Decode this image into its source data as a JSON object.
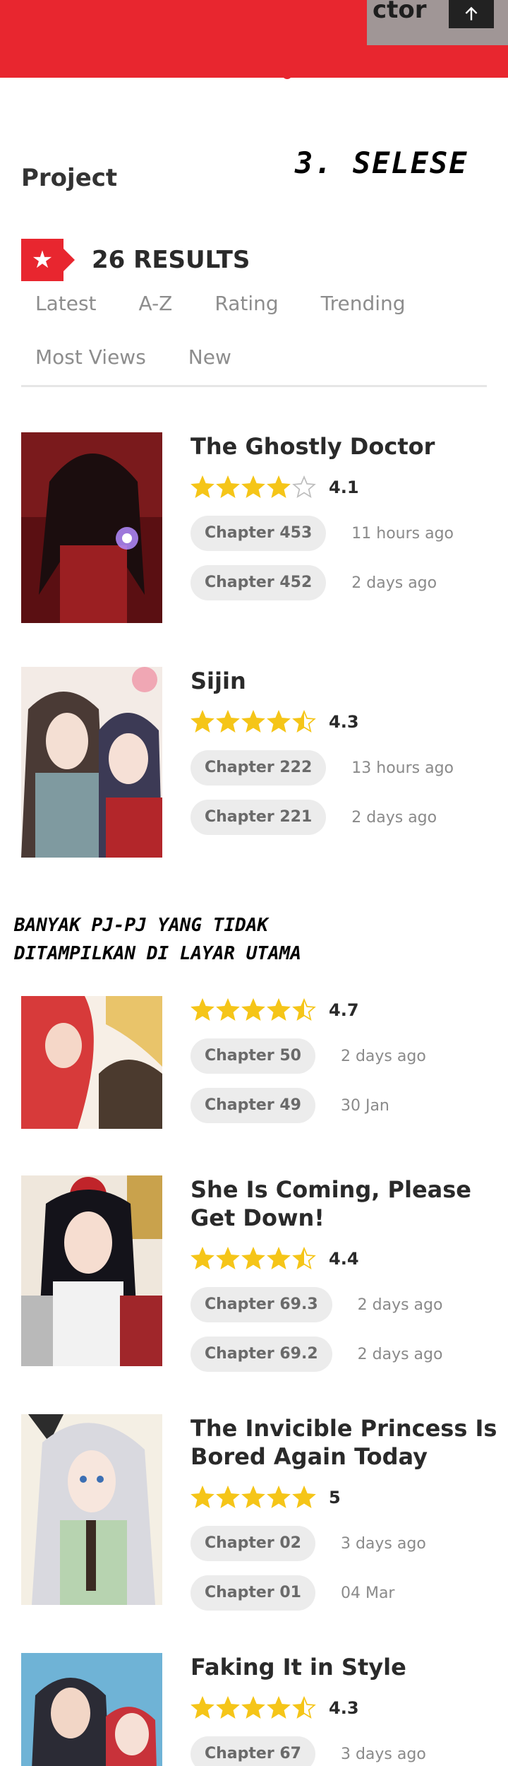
{
  "header": {
    "title_fragment": "ctor",
    "scroll_top_label": "back to top"
  },
  "annotations": {
    "top_note": "3. SELESE",
    "middle_note_line1": "BANYAK PJ-PJ YANG TIDAK",
    "middle_note_line2": "DITAMPILKAN DI LAYAR UTAMA"
  },
  "section": {
    "title": "Project",
    "results_count": "26 RESULTS",
    "sort_tabs": [
      "Latest",
      "A-Z",
      "Rating",
      "Trending",
      "Most Views",
      "New"
    ]
  },
  "colors": {
    "brand_red": "#e8262f",
    "star_yellow": "#f5c518",
    "chip_bg": "#ececec"
  },
  "items": [
    {
      "title": "The Ghostly Doctor",
      "rating": 4.1,
      "rating_label": "4.1",
      "chapters": [
        {
          "label": "Chapter 453",
          "time": "11 hours ago"
        },
        {
          "label": "Chapter 452",
          "time": "2 days ago"
        }
      ]
    },
    {
      "title": "Sijin",
      "rating": 4.3,
      "rating_label": "4.3",
      "chapters": [
        {
          "label": "Chapter 222",
          "time": "13 hours ago"
        },
        {
          "label": "Chapter 221",
          "time": "2 days ago"
        }
      ]
    },
    {
      "title": "",
      "rating": 4.7,
      "rating_label": "4.7",
      "chapters": [
        {
          "label": "Chapter 50",
          "time": "2 days ago"
        },
        {
          "label": "Chapter 49",
          "time": "30 Jan"
        }
      ]
    },
    {
      "title": "She Is Coming, Please Get Down!",
      "rating": 4.4,
      "rating_label": "4.4",
      "chapters": [
        {
          "label": "Chapter 69.3",
          "time": "2 days ago"
        },
        {
          "label": "Chapter 69.2",
          "time": "2 days ago"
        }
      ]
    },
    {
      "title": "The Invicible Princess Is Bored Again Today",
      "rating": 5,
      "rating_label": "5",
      "chapters": [
        {
          "label": "Chapter 02",
          "time": "3 days ago"
        },
        {
          "label": "Chapter 01",
          "time": "04 Mar"
        }
      ]
    },
    {
      "title": "Faking It in Style",
      "rating": 4.3,
      "rating_label": "4.3",
      "chapters": [
        {
          "label": "Chapter 67",
          "time": "3 days ago"
        }
      ]
    }
  ]
}
